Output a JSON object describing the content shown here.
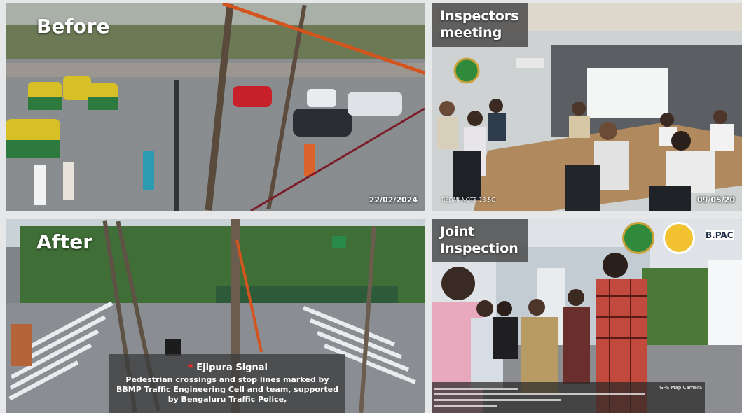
{
  "panels": {
    "before": {
      "label": "Before",
      "date": "22/02/2024"
    },
    "meeting": {
      "label": "Inspectors\nmeeting",
      "date": "09/05/20",
      "camera": "REDMI NOTE 13 5G"
    },
    "after": {
      "label": "After",
      "location": "Ejipura Signal",
      "description": "Pedestrian crossings and stop lines marked by BBMP Traffic Engineering Cell and team, supported by Bengaluru Traffic Police,"
    },
    "joint": {
      "label": "Joint\nInspection",
      "brand": "B.PAC",
      "gps_tag": "GPS Map Camera"
    }
  },
  "colors": {
    "overlay": "#464646",
    "pin": "#e22b2b",
    "brand": "#1c2a44"
  }
}
